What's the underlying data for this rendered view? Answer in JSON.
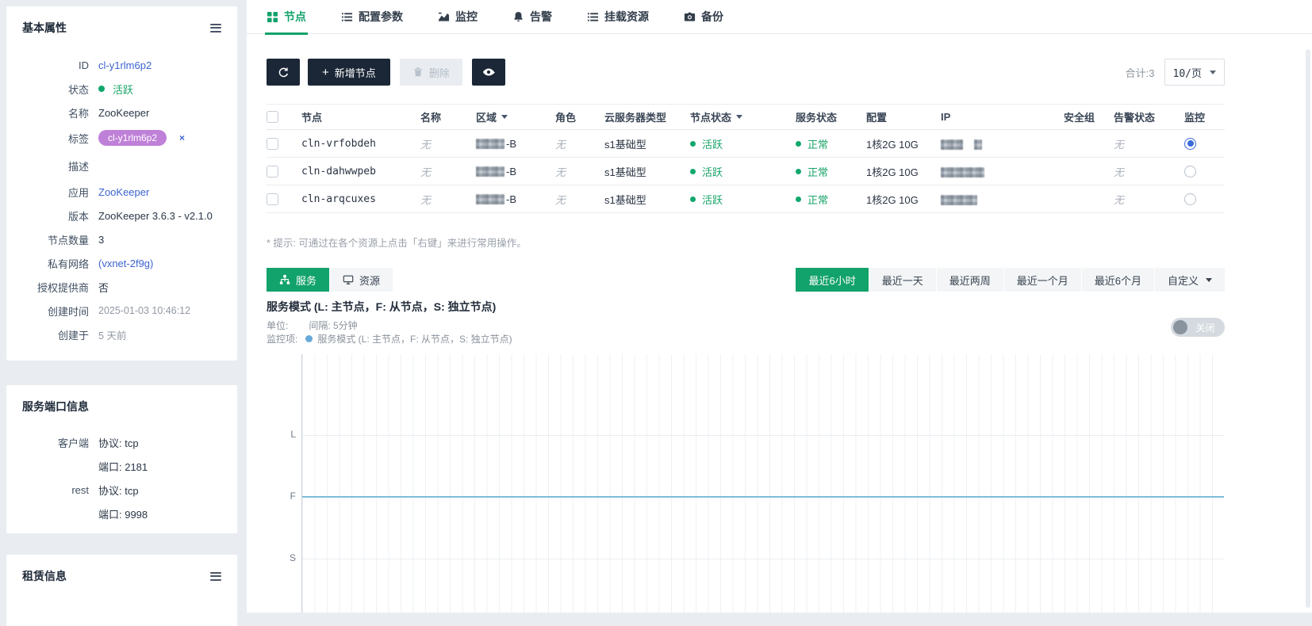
{
  "colors": {
    "accent_green": "#12a26b",
    "status_green": "#11a76d",
    "dark_button": "#1b2736",
    "link_blue": "#3c64d0",
    "tag_purple": "#bf80d8",
    "radio_blue": "#3b6bd8",
    "chart_line": "#7fbcd9",
    "legend_dot": "#68a9dc"
  },
  "sidebar": {
    "basic": {
      "title": "基本属性",
      "id_label": "ID",
      "id_value": "cl-y1rlm6p2",
      "status_label": "状态",
      "status_value": "活跃",
      "name_label": "名称",
      "name_value": "ZooKeeper",
      "tag_label": "标签",
      "tag_value": "cl-y1rlm6p2",
      "tag_remove": "×",
      "desc_label": "描述",
      "desc_value": "",
      "app_label": "应用",
      "app_value": "ZooKeeper",
      "version_label": "版本",
      "version_value": "ZooKeeper 3.6.3 - v2.1.0",
      "nodes_label": "节点数量",
      "nodes_value": "3",
      "vxnet_label": "私有网络",
      "vxnet_value": "(vxnet-2f9g)",
      "provider_label": "授权提供商",
      "provider_value": "否",
      "created_label": "创建时间",
      "created_value": "2025-01-03 10:46:12",
      "age_label": "创建于",
      "age_value": "5 天前"
    },
    "ports": {
      "title": "服务端口信息",
      "rows": [
        {
          "label": "客户端",
          "value": "协议: tcp"
        },
        {
          "label": "",
          "value": "端口: 2181"
        },
        {
          "label": "rest",
          "value": "协议: tcp"
        },
        {
          "label": "",
          "value": "端口: 9998"
        }
      ]
    },
    "lease": {
      "title": "租赁信息"
    }
  },
  "tabs": [
    {
      "label": "节点"
    },
    {
      "label": "配置参数"
    },
    {
      "label": "监控"
    },
    {
      "label": "告警"
    },
    {
      "label": "挂载资源"
    },
    {
      "label": "备份"
    }
  ],
  "toolbar": {
    "add_label": "新增节点",
    "delete_label": "删除",
    "total": "合计:3",
    "page_size": "10/页"
  },
  "table": {
    "headers": {
      "node": "节点",
      "name": "名称",
      "region": "区域",
      "role": "角色",
      "server_type": "云服务器类型",
      "node_status": "节点状态",
      "service_status": "服务状态",
      "config": "配置",
      "ip": "IP",
      "security_group": "安全组",
      "alarm": "告警状态",
      "monitor": "监控"
    },
    "rows": [
      {
        "node": "cln-vrfobdeh",
        "name": "无",
        "region_redacted": true,
        "region_suffix": "-B",
        "role": "无",
        "server_type": "s1基础型",
        "node_status": "活跃",
        "service_status": "正常",
        "config": "1核2G 10G",
        "ip_redacted": true,
        "security_group": "",
        "alarm": "无",
        "monitor_selected": true
      },
      {
        "node": "cln-dahwwpeb",
        "name": "无",
        "region_redacted": true,
        "region_suffix": "-B",
        "role": "无",
        "server_type": "s1基础型",
        "node_status": "活跃",
        "service_status": "正常",
        "config": "1核2G 10G",
        "ip_redacted": true,
        "security_group": "",
        "alarm": "无",
        "monitor_selected": false
      },
      {
        "node": "cln-arqcuxes",
        "name": "无",
        "region_redacted": true,
        "region_suffix": "-B",
        "role": "无",
        "server_type": "s1基础型",
        "node_status": "活跃",
        "service_status": "正常",
        "config": "1核2G 10G",
        "ip_redacted": true,
        "security_group": "",
        "alarm": "无",
        "monitor_selected": false
      }
    ]
  },
  "tip": "* 提示: 可通过在各个资源上点击「右键」来进行常用操作。",
  "monitor": {
    "view_service": "服务",
    "view_resource": "资源",
    "ranges": [
      "最近6小时",
      "最近一天",
      "最近两周",
      "最近一个月",
      "最近6个月",
      "自定义"
    ],
    "active_range": "最近6小时",
    "chart_title": "服务模式 (L: 主节点，F: 从节点，S: 独立节点)",
    "unit_label": "单位:",
    "interval_label": "间隔: 5分钟",
    "legend_label": "监控项:",
    "legend_text": "服务模式 (L: 主节点，F: 从节点，S: 独立节点)",
    "toggle_label": "关闭",
    "y_ticks": [
      "L",
      "F",
      "S"
    ]
  },
  "chart_data": {
    "type": "line",
    "title": "服务模式 (L: 主节点，F: 从节点，S: 独立节点)",
    "interval": "5分钟",
    "time_range": "最近6小时",
    "y_axis": {
      "type": "category",
      "ticks": [
        "L",
        "F",
        "S"
      ]
    },
    "series": [
      {
        "name": "服务模式 (L: 主节点，F: 从节点，S: 独立节点)",
        "color": "#7fbcd9",
        "constant_value": "F"
      }
    ],
    "legend_position": "top-left",
    "grid": true
  }
}
